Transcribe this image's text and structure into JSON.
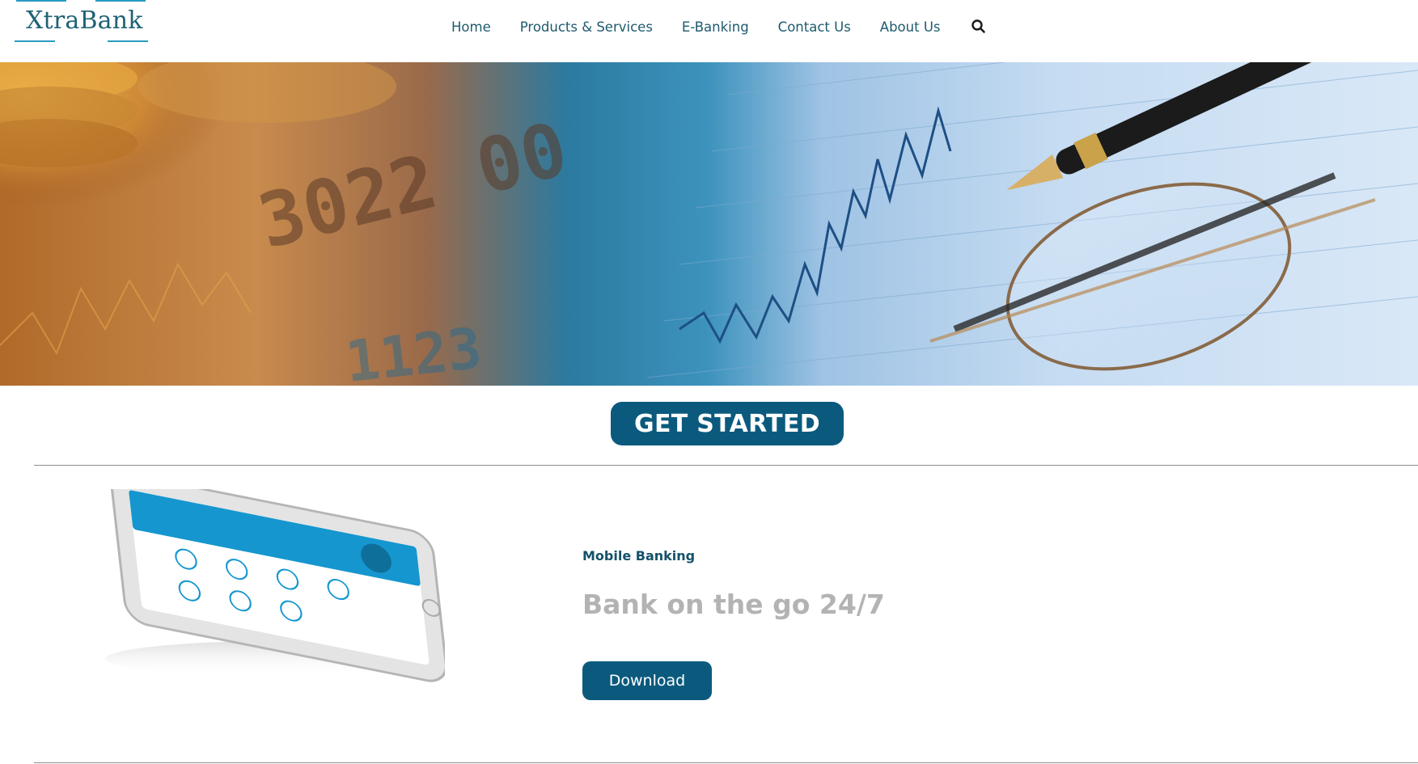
{
  "brand": {
    "name": "XtraBank",
    "accent": "#2a9bc4",
    "primary": "#0b5a7e"
  },
  "nav": {
    "items": [
      {
        "label": "Home"
      },
      {
        "label": "Products & Services"
      },
      {
        "label": "E-Banking"
      },
      {
        "label": "Contact Us"
      },
      {
        "label": "About Us"
      }
    ],
    "search_icon": "search-icon"
  },
  "hero": {
    "image": "banking-collage",
    "card_number_text": "3022 00",
    "digits_text": "1123"
  },
  "cta": {
    "label": "GET STARTED"
  },
  "mobile_section": {
    "label": "Mobile Banking",
    "headline": "Bank on the go 24/7",
    "download_label": "Download",
    "phone_image": "phone-mockup"
  }
}
